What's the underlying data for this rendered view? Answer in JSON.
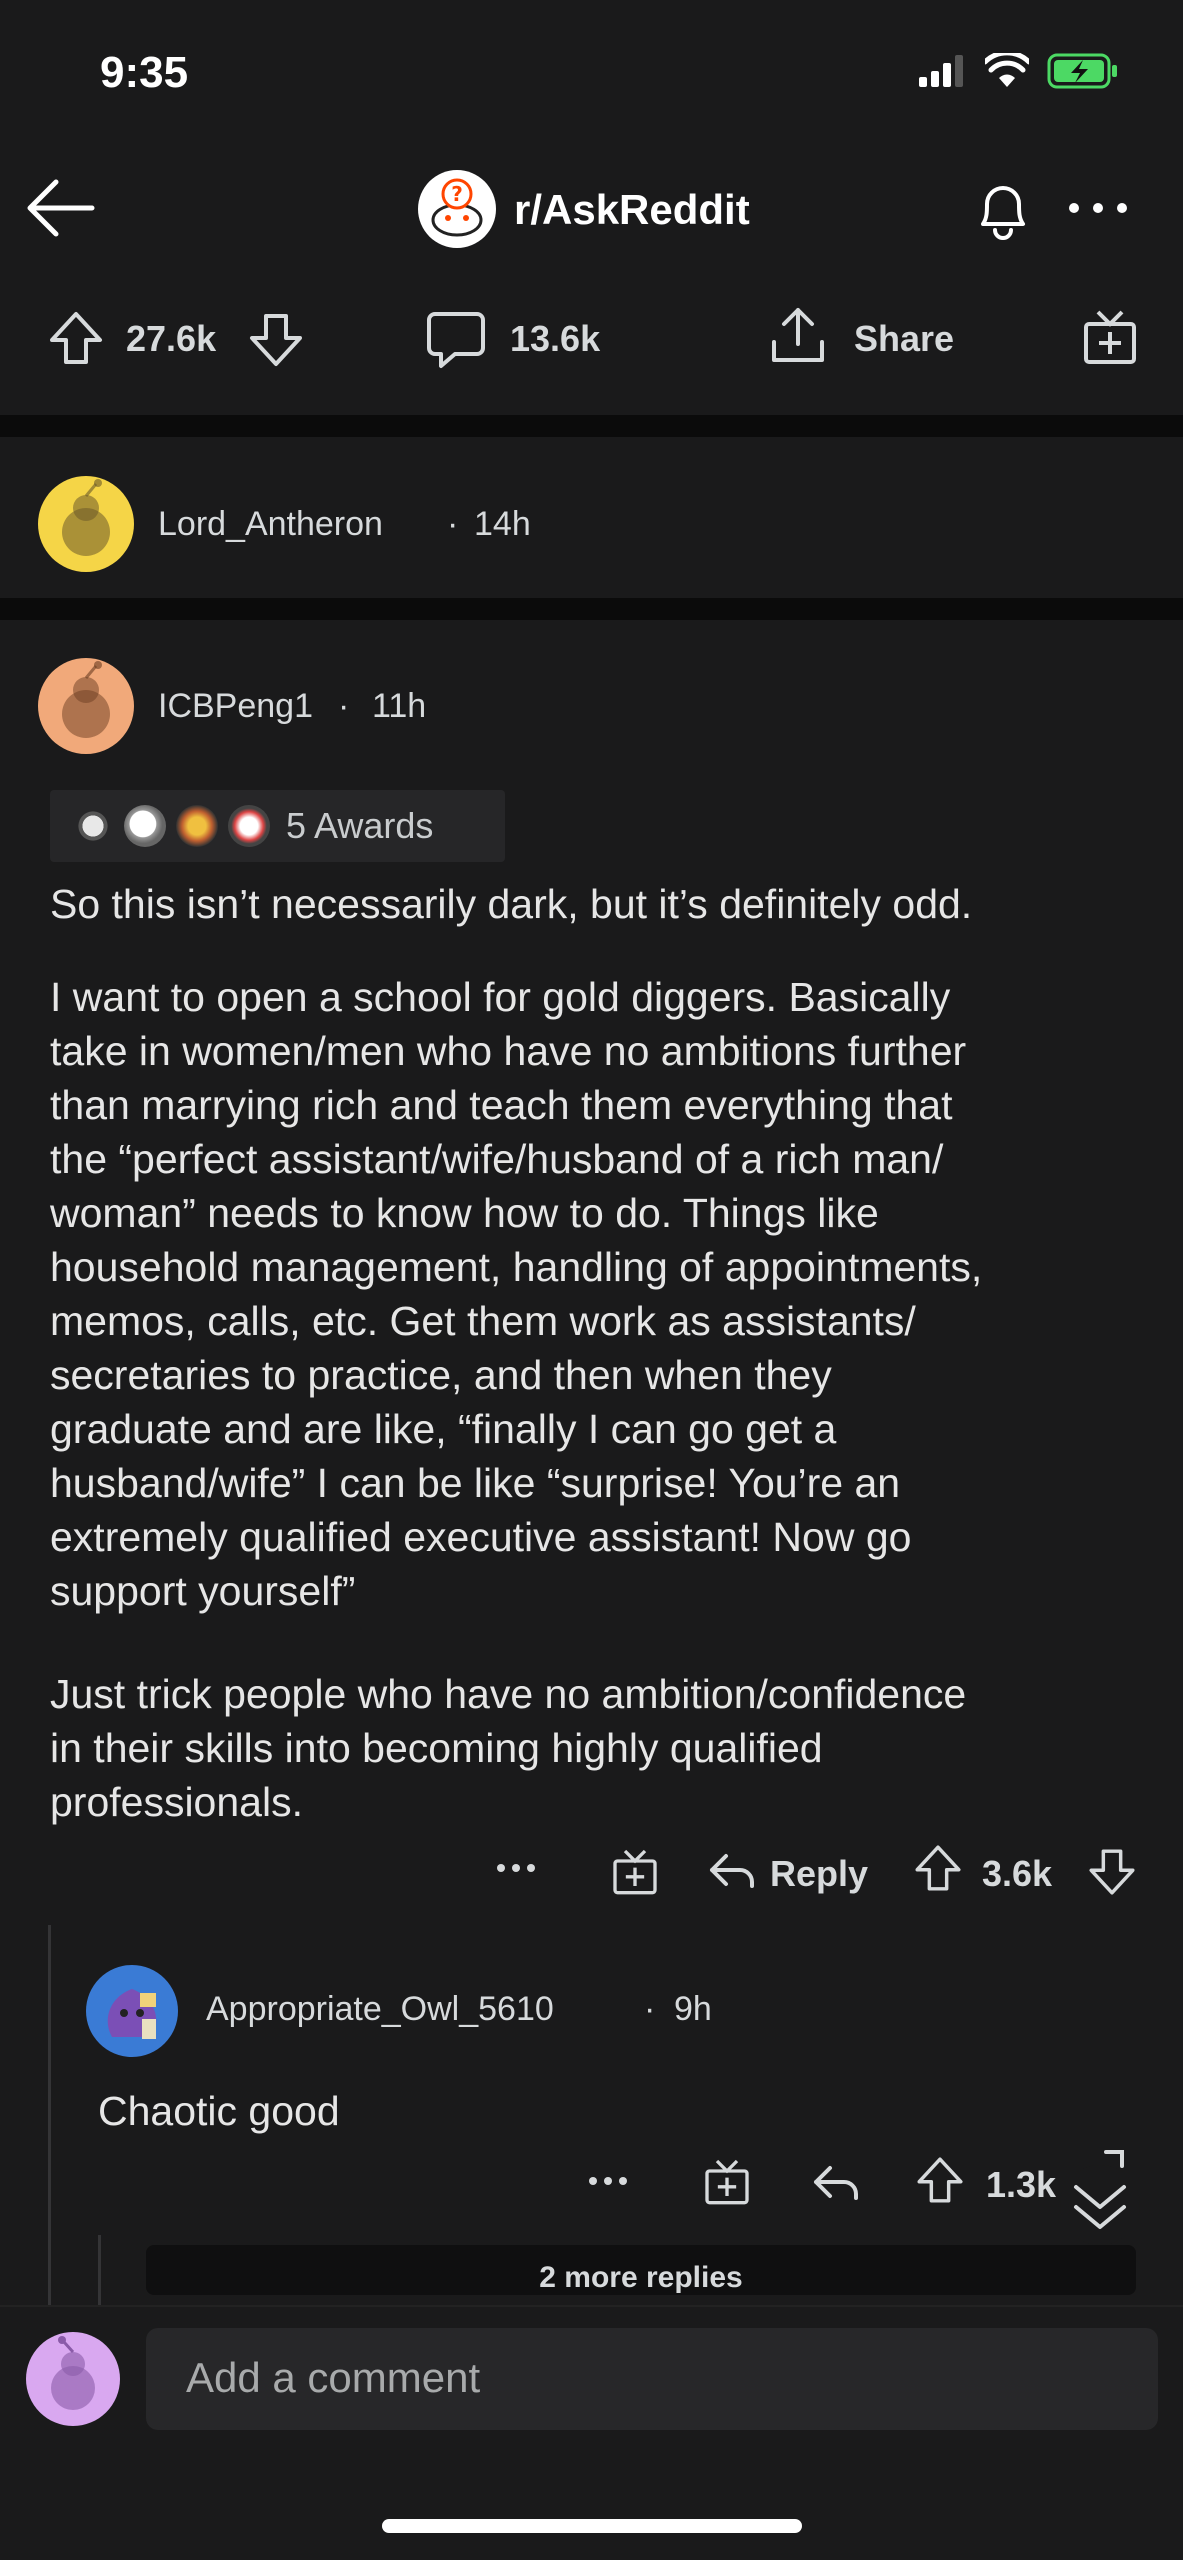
{
  "status": {
    "time": "9:35"
  },
  "header": {
    "subreddit": "r/AskReddit"
  },
  "post_actions": {
    "upvotes": "27.6k",
    "comments": "13.6k",
    "share": "Share"
  },
  "collapsed_comment": {
    "username": "Lord_Antheron",
    "age": "14h"
  },
  "main_comment": {
    "username": "ICBPeng1",
    "age": "11h",
    "awards_label": "5 Awards",
    "p1": "So this isn’t necessarily dark, but it’s definitely odd.",
    "p2": "I want to open a school for gold diggers. Basically\ntake in women/men who have no ambitions further\nthan marrying rich and teach them everything that\nthe “perfect assistant/wife/husband of a rich man/\nwoman” needs to know how to do. Things like\nhousehold management, handling of appointments,\nmemos, calls, etc. Get them work as assistants/\nsecretaries to practice, and then when they\ngraduate and are like, “finally I can go get a\nhusband/wife” I can be like “surprise! You’re an\nextremely qualified executive assistant! Now go\nsupport yourself”",
    "p3": "Just trick people who have no ambition/confidence\nin their skills into becoming highly qualified\nprofessionals.",
    "reply_label": "Reply",
    "score": "3.6k"
  },
  "reply_comment": {
    "username": "Appropriate_Owl_5610",
    "age": "9h",
    "text": "Chaotic good",
    "score": "1.3k"
  },
  "more_replies": "2 more replies",
  "composer": {
    "placeholder": "Add a comment"
  },
  "colors": {
    "background": "#1a1a1b",
    "divider": "#0b0b0b",
    "battery": "#4cd964"
  },
  "icons": [
    "back-arrow-icon",
    "bell-icon",
    "more-icon",
    "upvote-icon",
    "downvote-icon",
    "comment-icon",
    "share-icon",
    "award-icon",
    "reply-icon",
    "chevrons-down-icon"
  ]
}
